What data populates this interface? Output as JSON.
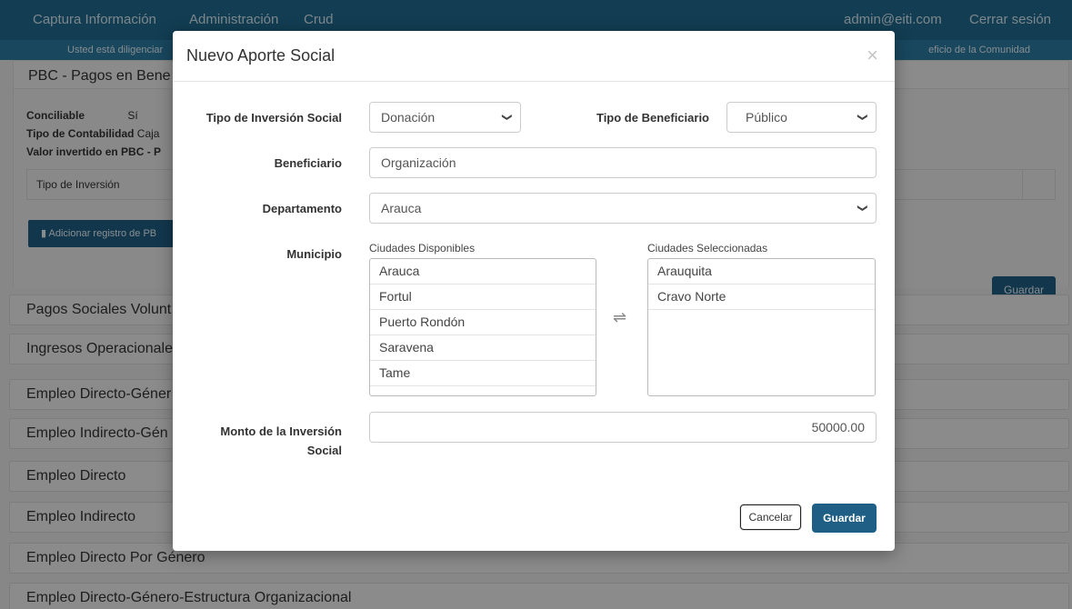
{
  "navbar": {
    "links": [
      "Captura Información",
      "Administración",
      "Crud"
    ],
    "user": "admin@eiti.com",
    "logout": "Cerrar sesión"
  },
  "subbar": {
    "left": "Usted está diligenciar",
    "right": "eficio de la Comunidad"
  },
  "pbc": {
    "title": "PBC - Pagos en Bene",
    "conciliable_label": "Conciliable",
    "conciliable_value": "Sí",
    "tipo_contab_label": "Tipo de Contabilidad",
    "tipo_contab_value": "Caja",
    "valor_label": "Valor invertido en PBC - P",
    "table_header": "Tipo de Inversión",
    "add_button": "Adicionar registro de PB",
    "save_button": "Guardar"
  },
  "accordion": [
    "Pagos Sociales Volunt",
    "Ingresos Operacionale",
    "Empleo Directo-Géner",
    "Empleo Indirecto-Gén",
    "Empleo Directo",
    "Empleo Indirecto",
    "Empleo Directo Por Género",
    "Empleo Directo-Género-Estructura Organizacional"
  ],
  "modal": {
    "title": "Nuevo Aporte Social",
    "close": "×",
    "tipo_inversion": {
      "label": "Tipo de Inversión Social",
      "value": "Donación"
    },
    "tipo_beneficiario": {
      "label": "Tipo de Beneficiario",
      "value": "Público"
    },
    "beneficiario": {
      "label": "Beneficiario",
      "value": "Organización"
    },
    "departamento": {
      "label": "Departamento",
      "value": "Arauca"
    },
    "municipio": {
      "label": "Municipio",
      "available_caption": "Ciudades Disponibles",
      "selected_caption": "Ciudades Seleccionadas",
      "available": [
        "Arauca",
        "Fortul",
        "Puerto Rondón",
        "Saravena",
        "Tame"
      ],
      "selected": [
        "Arauquita",
        "Cravo Norte"
      ]
    },
    "monto": {
      "label_line1": "Monto de la Inversión",
      "label_line2": "Social",
      "value": "50000.00"
    },
    "cancel_button": "Cancelar",
    "save_button": "Guardar"
  },
  "icons": {
    "caret": "chevron-down-icon",
    "swap": "swap-arrows-icon",
    "chart": "bar-chart-icon"
  },
  "colors": {
    "navbar": "#1f6a8e",
    "primary_button": "#1f5f86"
  }
}
